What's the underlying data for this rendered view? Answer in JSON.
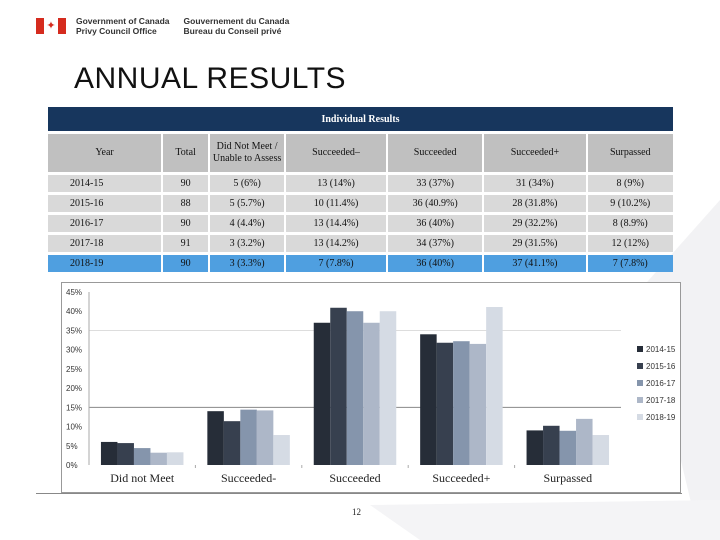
{
  "header": {
    "org_en_line1": "Government of Canada",
    "org_en_line2": "Privy Council Office",
    "org_fr_line1": "Gouvernement du Canada",
    "org_fr_line2": "Bureau du Conseil privé",
    "flag_icon": "canada-flag-icon"
  },
  "page_title": "ANNUAL RESULTS",
  "table": {
    "banner": "Individual Results",
    "headers": [
      "Year",
      "Total",
      "Did Not Meet / Unable to Assess",
      "Succeeded–",
      "Succeeded",
      "Succeeded+",
      "Surpassed"
    ],
    "rows": [
      [
        "2014-15",
        "90",
        "5 (6%)",
        "13 (14%)",
        "33 (37%)",
        "31 (34%)",
        "8 (9%)"
      ],
      [
        "2015-16",
        "88",
        "5 (5.7%)",
        "10 (11.4%)",
        "36 (40.9%)",
        "28 (31.8%)",
        "9 (10.2%)"
      ],
      [
        "2016-17",
        "90",
        "4 (4.4%)",
        "13 (14.4%)",
        "36 (40%)",
        "29 (32.2%)",
        "8 (8.9%)"
      ],
      [
        "2017-18",
        "91",
        "3 (3.2%)",
        "13 (14.2%)",
        "34 (37%)",
        "29 (31.5%)",
        "12 (12%)"
      ],
      [
        "2018-19",
        "90",
        "3 (3.3%)",
        "7 (7.8%)",
        "36 (40%)",
        "37 (41.1%)",
        "7 (7.8%)"
      ]
    ],
    "highlight_row": 4,
    "colors": {
      "banner": "#17365d",
      "header": "#c0c0c0",
      "cell": "#d9d9d9",
      "highlight": "#4f9fe0"
    }
  },
  "chart_data": {
    "type": "bar",
    "title": "",
    "xlabel": "",
    "ylabel": "",
    "categories": [
      "Did not Meet",
      "Succeeded-",
      "Succeeded",
      "Succeeded+",
      "Surpassed"
    ],
    "series": [
      {
        "name": "2014-15",
        "color": "#262d38",
        "values": [
          6,
          14,
          37,
          34,
          9
        ]
      },
      {
        "name": "2015-16",
        "color": "#37404f",
        "values": [
          5.7,
          11.4,
          40.9,
          31.8,
          10.2
        ]
      },
      {
        "name": "2016-17",
        "color": "#8595ac",
        "values": [
          4.4,
          14.4,
          40,
          32.2,
          8.9
        ]
      },
      {
        "name": "2017-18",
        "color": "#adb7c8",
        "values": [
          3.2,
          14.2,
          37,
          31.5,
          12
        ]
      },
      {
        "name": "2018-19",
        "color": "#d5dbe4",
        "values": [
          3.3,
          7.8,
          40,
          41.1,
          7.8
        ]
      }
    ],
    "yticks": [
      "0%",
      "5%",
      "10%",
      "15%",
      "20%",
      "25%",
      "30%",
      "35%",
      "40%",
      "45%"
    ],
    "ylim": [
      0,
      45
    ],
    "grid": true,
    "legend": "right"
  },
  "page_number": "12"
}
